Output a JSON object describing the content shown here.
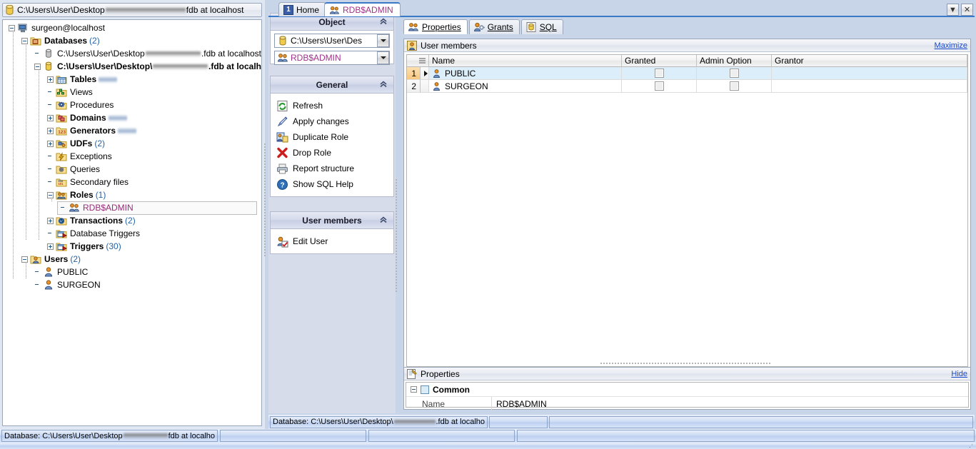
{
  "window": {
    "title_prefix": "C:\\Users\\User\\Desktop",
    "title_suffix": "fdb at localhost",
    "dropdown_icon": "chevron-down-icon",
    "close_icon": "close-icon"
  },
  "app_tabs": [
    {
      "label": "Home",
      "icon": "number-one-badge-icon",
      "active": false
    },
    {
      "label": "RDB$ADMIN",
      "icon": "role-icon",
      "active": true
    }
  ],
  "tree": [
    {
      "label": "surgeon@localhost",
      "icon": "server-icon",
      "indent": 0,
      "expander": "minus",
      "bold": false,
      "count": ""
    },
    {
      "label": "Databases",
      "icon": "folder-db-icon",
      "indent": 1,
      "expander": "minus",
      "bold": true,
      "count": "(2)"
    },
    {
      "label": "C:\\Users\\User\\Desktop",
      "label_suffix": ".fdb at localhost",
      "icon": "database-gray-icon",
      "indent": 2,
      "expander": "none",
      "bold": false,
      "redacted": true,
      "count": ""
    },
    {
      "label": "C:\\Users\\User\\Desktop\\",
      "label_suffix": ".fdb at localh",
      "icon": "database-yellow-icon",
      "indent": 2,
      "expander": "minus",
      "bold": true,
      "redacted": true,
      "count": ""
    },
    {
      "label": "Tables",
      "icon": "table-icon",
      "indent": 3,
      "expander": "plus",
      "bold": true,
      "count_blurred": true
    },
    {
      "label": "Views",
      "icon": "view-icon",
      "indent": 3,
      "expander": "none",
      "bold": false,
      "count": ""
    },
    {
      "label": "Procedures",
      "icon": "procedure-icon",
      "indent": 3,
      "expander": "none",
      "bold": false,
      "count": ""
    },
    {
      "label": "Domains",
      "icon": "domain-icon",
      "indent": 3,
      "expander": "plus",
      "bold": true,
      "count_blurred": true
    },
    {
      "label": "Generators",
      "icon": "generator-icon",
      "indent": 3,
      "expander": "plus",
      "bold": true,
      "count_blurred": true
    },
    {
      "label": "UDFs",
      "icon": "udf-icon",
      "indent": 3,
      "expander": "plus",
      "bold": true,
      "count": "(2)"
    },
    {
      "label": "Exceptions",
      "icon": "exception-icon",
      "indent": 3,
      "expander": "none",
      "bold": false,
      "count": ""
    },
    {
      "label": "Queries",
      "icon": "query-icon",
      "indent": 3,
      "expander": "none",
      "bold": false,
      "count": ""
    },
    {
      "label": "Secondary files",
      "icon": "secondary-files-icon",
      "indent": 3,
      "expander": "none",
      "bold": false,
      "count": ""
    },
    {
      "label": "Roles",
      "icon": "roles-icon",
      "indent": 3,
      "expander": "minus",
      "bold": true,
      "count": "(1)"
    },
    {
      "label": "RDB$ADMIN",
      "icon": "role-icon",
      "indent": 4,
      "expander": "none",
      "bold": false,
      "selected": true,
      "count": ""
    },
    {
      "label": "Transactions",
      "icon": "transaction-icon",
      "indent": 3,
      "expander": "plus",
      "bold": true,
      "count": "(2)"
    },
    {
      "label": "Database Triggers",
      "icon": "trigger-icon",
      "indent": 3,
      "expander": "none",
      "bold": false,
      "count": ""
    },
    {
      "label": "Triggers",
      "icon": "trigger-icon",
      "indent": 3,
      "expander": "plus",
      "bold": true,
      "count": "(30)"
    },
    {
      "label": "Users",
      "icon": "users-icon",
      "indent": 1,
      "expander": "minus",
      "bold": true,
      "count": "(2)"
    },
    {
      "label": "PUBLIC",
      "icon": "user-icon",
      "indent": 2,
      "expander": "none",
      "bold": false,
      "count": ""
    },
    {
      "label": "SURGEON",
      "icon": "user-icon",
      "indent": 2,
      "expander": "none",
      "bold": false,
      "count": ""
    }
  ],
  "sidebar": {
    "object": {
      "title": "Object",
      "collapse_icon": "chevron-up-double-icon",
      "database_combo": {
        "value": "C:\\Users\\User\\Des",
        "icon": "database-yellow-icon"
      },
      "role_combo": {
        "value": "RDB$ADMIN",
        "icon": "role-icon"
      }
    },
    "general": {
      "title": "General",
      "collapse_icon": "chevron-up-double-icon",
      "actions": [
        {
          "label": "Refresh",
          "icon": "refresh-icon"
        },
        {
          "label": "Apply changes",
          "icon": "apply-changes-icon"
        },
        {
          "label": "Duplicate Role",
          "icon": "duplicate-role-icon"
        },
        {
          "label": "Drop Role",
          "icon": "drop-role-icon"
        },
        {
          "label": "Report structure",
          "icon": "printer-icon"
        },
        {
          "label": "Show SQL Help",
          "icon": "help-icon"
        }
      ]
    },
    "user_members": {
      "title": "User members",
      "collapse_icon": "chevron-up-double-icon",
      "actions": [
        {
          "label": "Edit User",
          "icon": "edit-user-icon"
        }
      ]
    }
  },
  "content_tabs": [
    {
      "label": "Properties",
      "icon": "role-icon",
      "active": true
    },
    {
      "label": "Grants",
      "icon": "grants-icon",
      "active": false
    },
    {
      "label": "SQL",
      "icon": "sql-icon",
      "active": false
    }
  ],
  "user_members_panel": {
    "header": "User members",
    "header_icon": "user-members-icon",
    "maximize_label": "Maximize",
    "columns": [
      "Name",
      "Granted",
      "Admin Option",
      "Grantor"
    ],
    "rows": [
      {
        "num": "1",
        "name": "PUBLIC",
        "granted": false,
        "admin_option": false,
        "grantor": "",
        "current": true
      },
      {
        "num": "2",
        "name": "SURGEON",
        "granted": false,
        "admin_option": false,
        "grantor": "",
        "current": false
      }
    ]
  },
  "properties_panel": {
    "header": "Properties",
    "header_icon": "properties-icon",
    "hide_label": "Hide",
    "group": "Common",
    "rows": [
      {
        "name": "Name",
        "value": "RDB$ADMIN"
      }
    ]
  },
  "status": {
    "middle_db": "Database: C:\\Users\\User\\Desktop\\",
    "middle_db_suffix": ".fdb at localho",
    "bottom_db": "Database: C:\\Users\\User\\Desktop",
    "bottom_db_suffix": "fdb at localho"
  },
  "colors": {
    "accent_link": "#1a49c8",
    "selection_row": "#ddeefb",
    "magenta_text": "#a0338a",
    "count_blue": "#2464a8"
  }
}
